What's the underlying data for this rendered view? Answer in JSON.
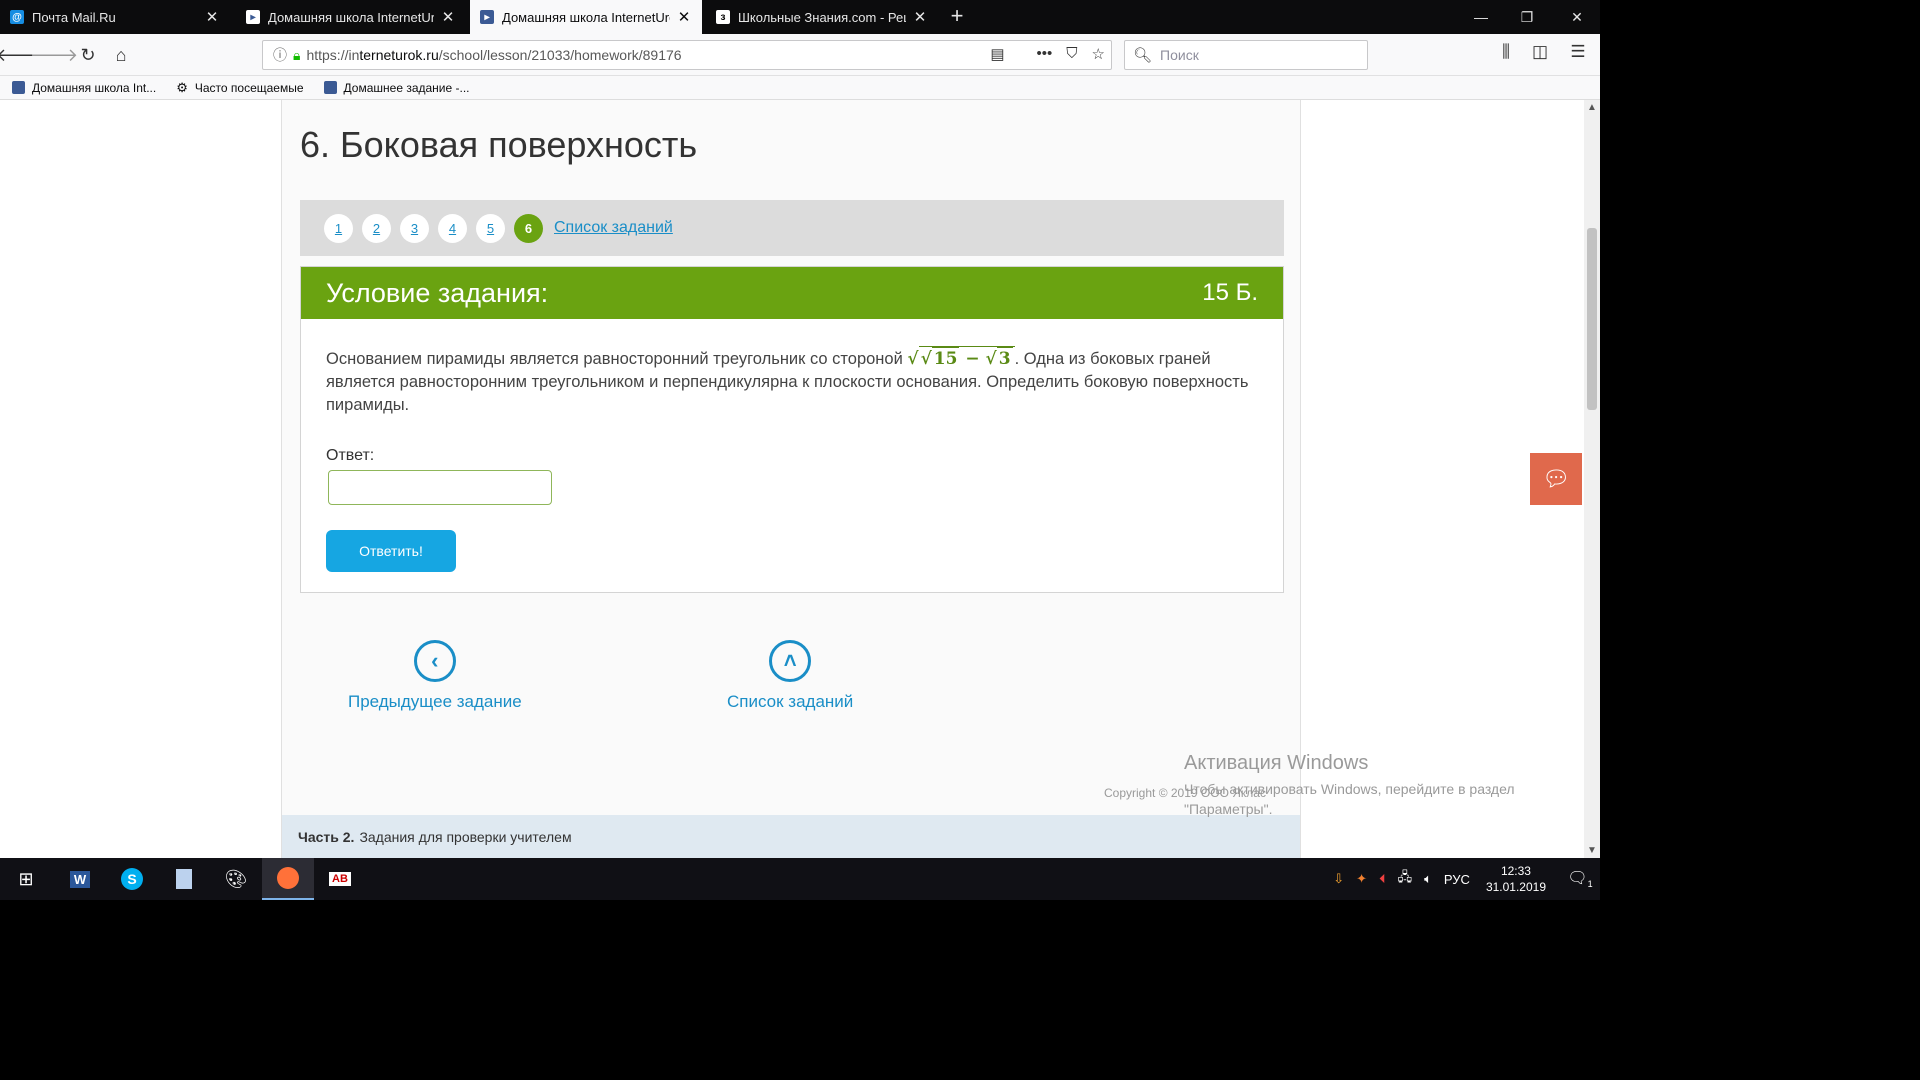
{
  "browser": {
    "tabs": [
      {
        "label": "Почта Mail.Ru",
        "icon": "mailru-icon",
        "close": "✕"
      },
      {
        "label": "Домашняя школа InternetUrok",
        "icon": "interneturok-icon",
        "close": "✕"
      },
      {
        "label": "Домашняя школа InternetUrok",
        "icon": "interneturok-icon",
        "close": "✕"
      },
      {
        "label": "Школьные Знания.com - Реш...",
        "icon": "znanija-icon",
        "close": "✕"
      }
    ],
    "new_tab": "+",
    "url_prefix": "https://in",
    "url_host": "terneturok.ru",
    "url_path": "/school/lesson/21033/homework/89176",
    "search_placeholder": "Поиск",
    "bookmarks": [
      {
        "label": "Домашняя школа Int..."
      },
      {
        "label": "Часто посещаемые"
      },
      {
        "label": "Домашнее задание -..."
      }
    ]
  },
  "page": {
    "title": "6. Боковая поверхность",
    "pager": {
      "numbers": [
        "1",
        "2",
        "3",
        "4",
        "5",
        "6"
      ],
      "current": "6",
      "tasks_link": "Список заданий"
    },
    "task": {
      "header_title": "Условие задания:",
      "points": "15 Б.",
      "text_before": "Основанием пирамиды является равносторонний треугольник со стороной ",
      "math_outer": "√",
      "math_inner_a": "15",
      "math_minus": " − ",
      "math_inner_root": "√",
      "math_inner_b": "3",
      "text_after": ". Одна из боковых граней является равносторонним треугольником и перпендикулярна к плоскости основания. Определить боковую поверхность пирамиды.",
      "answer_label": "Ответ:",
      "answer_value": "",
      "submit_label": "Ответить!"
    },
    "prev_link": "Предыдущее задание",
    "list_link": "Список заданий",
    "copyright": "Copyright © 2019 ООО Яклас",
    "footer_bold": "Часть 2.",
    "footer_text": "Задания для проверки учителем"
  },
  "overlay": {
    "activation_title": "Активация Windows",
    "activation_text_1": "Чтобы активировать Windows, перейдите в раздел",
    "activation_text_2": "\"Параметры\"."
  },
  "taskbar": {
    "lang": "РУС",
    "time": "12:33",
    "date": "31.01.2019",
    "notif_count": "1"
  },
  "colors": {
    "green": "#6aa311",
    "blue": "#1a8ec7",
    "button": "#16a6e2",
    "chat": "#e0694c"
  }
}
